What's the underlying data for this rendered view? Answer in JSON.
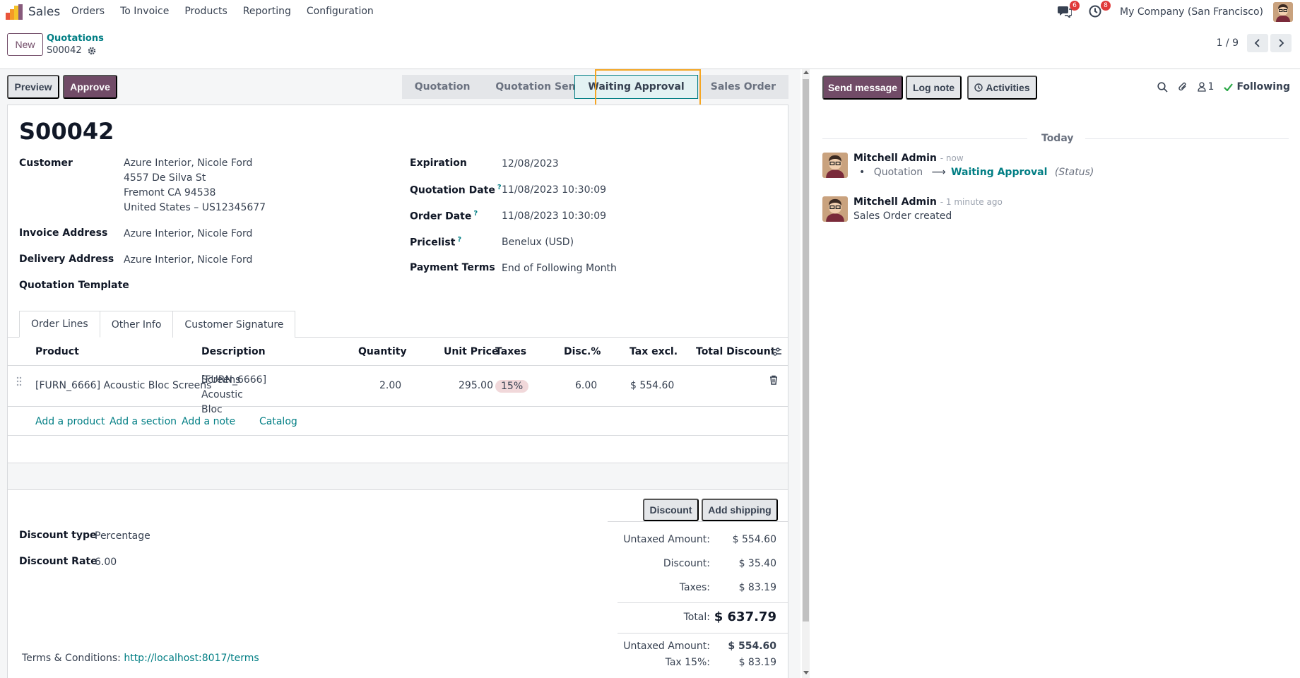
{
  "navbar": {
    "app_name": "Sales",
    "menu": [
      "Orders",
      "To Invoice",
      "Products",
      "Reporting",
      "Configuration"
    ],
    "messages_count": "6",
    "activities_count": "8",
    "company": "My Company (San Francisco)"
  },
  "control": {
    "new_label": "New",
    "breadcrumb_parent": "Quotations",
    "breadcrumb_current": "S00042",
    "pager": "1 / 9"
  },
  "statusbar": {
    "preview_label": "Preview",
    "approve_label": "Approve",
    "stages": [
      "Quotation",
      "Quotation Sent",
      "Waiting Approval",
      "Sales Order"
    ],
    "active_stage": "Waiting Approval"
  },
  "form": {
    "name": "S00042",
    "customer_label": "Customer",
    "customer_lines": [
      "Azure Interior, Nicole Ford",
      "4557 De Silva St",
      "Fremont CA 94538",
      "United States – US12345677"
    ],
    "invoice_address_label": "Invoice Address",
    "invoice_address": "Azure Interior, Nicole Ford",
    "delivery_address_label": "Delivery Address",
    "delivery_address": "Azure Interior, Nicole Ford",
    "quotation_template_label": "Quotation Template",
    "expiration_label": "Expiration",
    "expiration": "12/08/2023",
    "quotation_date_label": "Quotation Date",
    "quotation_date": "11/08/2023 10:30:09",
    "order_date_label": "Order Date",
    "order_date": "11/08/2023 10:30:09",
    "pricelist_label": "Pricelist",
    "pricelist": "Benelux (USD)",
    "payment_terms_label": "Payment Terms",
    "payment_terms": "End of Following Month",
    "help_mark": "?"
  },
  "tabs": [
    "Order Lines",
    "Other Info",
    "Customer Signature"
  ],
  "order_lines": {
    "headers": [
      "Product",
      "Description",
      "Quantity",
      "Unit Price",
      "Taxes",
      "Disc.%",
      "Tax excl.",
      "Total Discount"
    ],
    "rows": [
      {
        "product": "[FURN_6666] Acoustic Bloc Screens",
        "description_1": "[FURN_6666] Acoustic Bloc",
        "description_2": "Screens",
        "quantity": "2.00",
        "unit_price": "295.00",
        "taxes": "15%",
        "discount": "6.00",
        "tax_excl": "$ 554.60"
      }
    ],
    "add_links": [
      "Add a product",
      "Add a section",
      "Add a note",
      "Catalog"
    ]
  },
  "bottom": {
    "discount_button": "Discount",
    "shipping_button": "Add shipping",
    "discount_type_label": "Discount type",
    "discount_type": "Percentage",
    "discount_rate_label": "Discount Rate",
    "discount_rate": "6.00",
    "totals": {
      "untaxed_label": "Untaxed Amount:",
      "untaxed": "$ 554.60",
      "discount_label": "Discount:",
      "discount": "$ 35.40",
      "taxes_label": "Taxes:",
      "taxes": "$ 83.19",
      "total_label": "Total:",
      "total": "$ 637.79"
    },
    "tax_totals": {
      "untaxed_label": "Untaxed Amount:",
      "untaxed": "$ 554.60",
      "tax_label": "Tax 15%:",
      "tax": "$ 83.19"
    },
    "terms_label": "Terms & Conditions:",
    "terms_link": "http://localhost:8017/terms"
  },
  "chatter": {
    "send_message": "Send message",
    "log_note": "Log note",
    "activities": "Activities",
    "followers_count": "1",
    "following": "Following",
    "today": "Today",
    "messages": [
      {
        "author": "Mitchell Admin",
        "date": "- now",
        "old_value": "Quotation",
        "arrow": "⟶",
        "new_value": "Waiting Approval",
        "field": "(Status)"
      },
      {
        "author": "Mitchell Admin",
        "date": "- 1 minute ago",
        "body": "Sales Order created"
      }
    ]
  },
  "colors": {
    "brand": "#714b67",
    "link": "#017e84",
    "highlight": "#f5a623",
    "following": "#28a745"
  }
}
